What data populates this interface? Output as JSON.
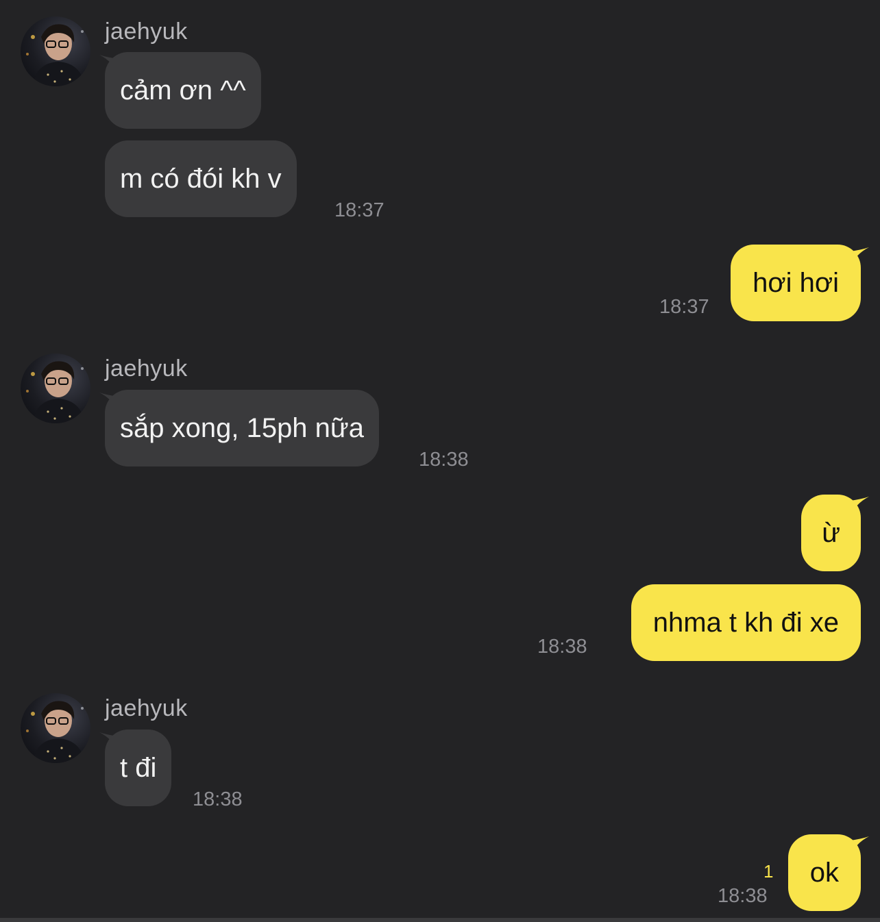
{
  "contact": {
    "name": "jaehyuk"
  },
  "colors": {
    "background": "#232325",
    "incoming_bubble": "#3a3a3c",
    "outgoing_bubble": "#f9e44b",
    "timestamp": "#8e8e93",
    "unread_count": "#f9e44b"
  },
  "messages": [
    {
      "sender": "jaehyuk",
      "direction": "incoming",
      "text": "cảm ơn ^^"
    },
    {
      "sender": "jaehyuk",
      "direction": "incoming",
      "text": "m có đói kh v",
      "time": "18:37"
    },
    {
      "direction": "outgoing",
      "text": "hơi hơi",
      "time": "18:37"
    },
    {
      "sender": "jaehyuk",
      "direction": "incoming",
      "text": "sắp xong, 15ph nữa",
      "time": "18:38"
    },
    {
      "direction": "outgoing",
      "text": "ừ"
    },
    {
      "direction": "outgoing",
      "text": "nhma t kh đi xe",
      "time": "18:38"
    },
    {
      "sender": "jaehyuk",
      "direction": "incoming",
      "text": "t đi",
      "time": "18:38"
    },
    {
      "direction": "outgoing",
      "text": "ok",
      "time": "18:38",
      "unread_count": "1"
    }
  ]
}
